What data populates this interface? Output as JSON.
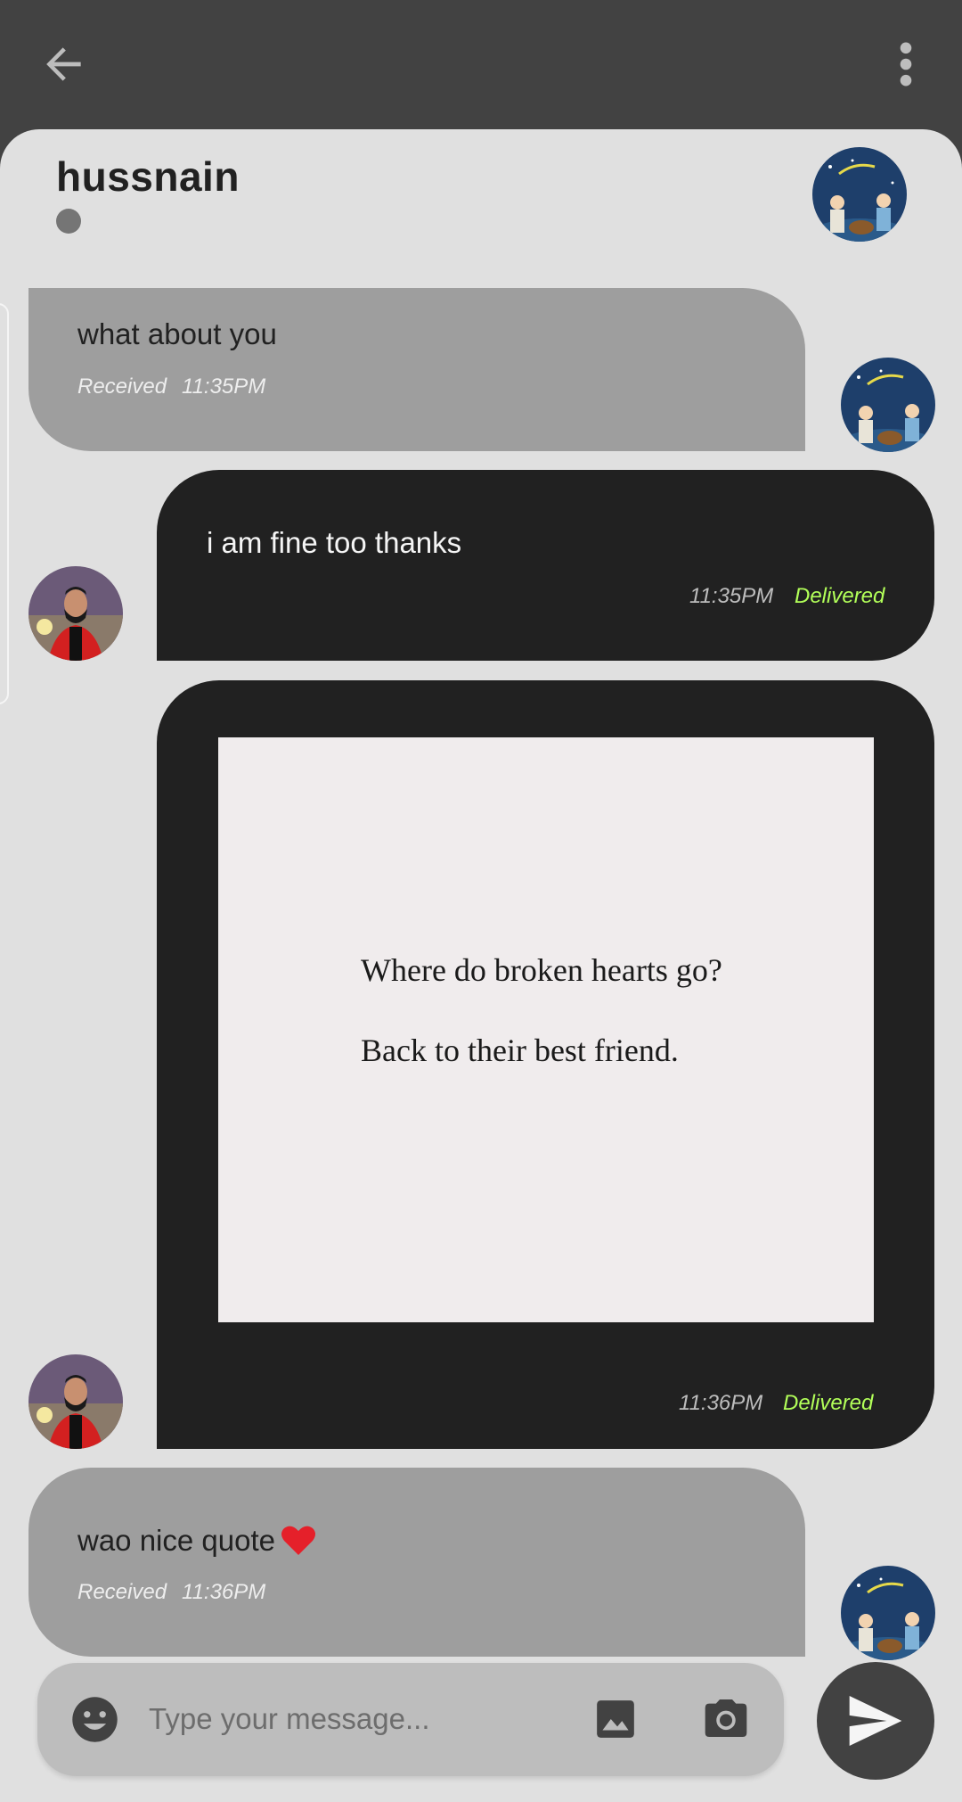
{
  "appbar": {
    "back_icon": "arrow-left-icon",
    "more_icon": "more-vert-icon",
    "background": "#424242"
  },
  "contact": {
    "name": "hussnain",
    "status_color": "#757575"
  },
  "messages": [
    {
      "direction": "received",
      "text": "what about you",
      "status": "Received",
      "time": "11:35PM"
    },
    {
      "direction": "sent",
      "text": "i am fine too thanks",
      "time": "11:35PM",
      "status": "Delivered"
    },
    {
      "direction": "sent",
      "type": "image",
      "image_text": [
        "Where do broken hearts go?",
        "Back to their best friend."
      ],
      "time": "11:36PM",
      "status": "Delivered"
    },
    {
      "direction": "received",
      "text": "wao nice quote",
      "emoji": "heart",
      "status": "Received",
      "time": "11:36PM"
    }
  ],
  "composer": {
    "placeholder": "Type your message...",
    "emoji_icon": "emoji-icon",
    "gallery_icon": "image-icon",
    "camera_icon": "camera-icon",
    "send_icon": "send-icon"
  },
  "colors": {
    "received_bubble": "#9e9e9e",
    "sent_bubble": "#212121",
    "delivered": "#b2ff59",
    "sheet": "#e0e0e0"
  }
}
